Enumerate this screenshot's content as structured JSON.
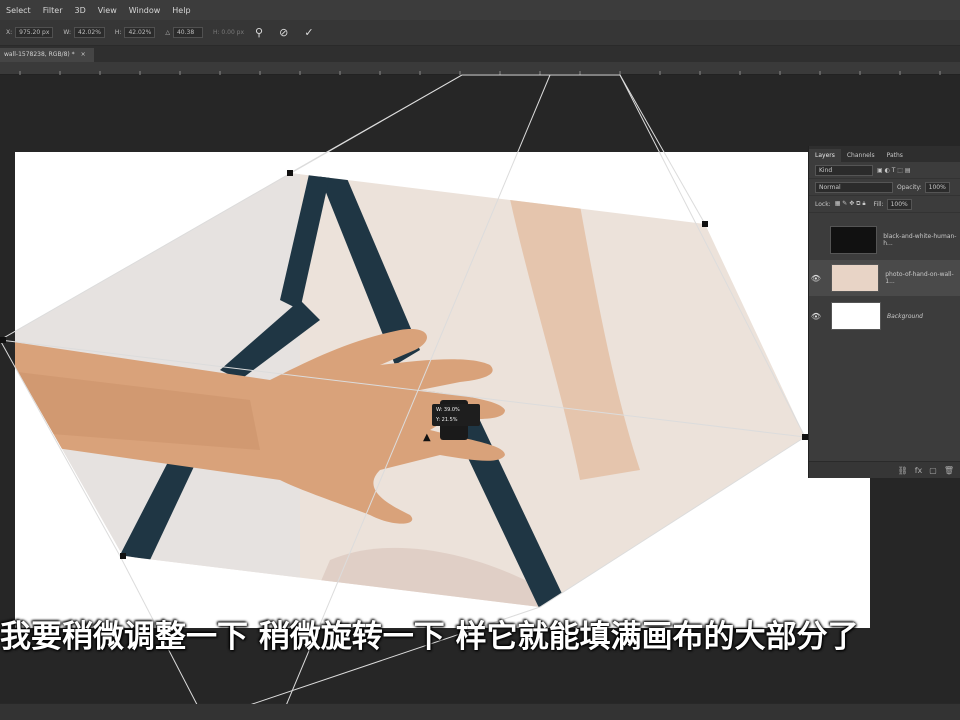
{
  "menu": [
    "Select",
    "Filter",
    "3D",
    "View",
    "Window",
    "Help"
  ],
  "options": {
    "x_label": "X:",
    "x_value": "975.20 px",
    "w_label": "W:",
    "w_value": "42.02%",
    "h_label": "H:",
    "h_value": "42.02%",
    "angle_label": "△",
    "angle_value": "40.38",
    "interp_value": "H: 0.00 px",
    "warp_icon": "puppet-warp-icon",
    "cancel_icon": "cancel-icon",
    "commit_icon": "commit-icon"
  },
  "document_tab": {
    "label": "wall-1578238, RGB/8) *",
    "close": "×"
  },
  "readout": {
    "line1": "W: 39.0%",
    "line2": "Y: 21.5%"
  },
  "subtitle": "我要稍微调整一下 稍微旋转一下 样它就能填满画布的大部分了",
  "layers_panel": {
    "tabs": [
      "Layers",
      "Channels",
      "Paths"
    ],
    "search_placeholder": "Kind",
    "blend_mode": "Normal",
    "opacity_label": "Opacity:",
    "opacity_value": "100%",
    "lock_label": "Lock:",
    "fill_label": "Fill:",
    "fill_value": "100%",
    "layers": [
      {
        "name": "black-and-white-human-h...",
        "visible": false,
        "selected": false
      },
      {
        "name": "photo-of-hand-on-wall-1...",
        "visible": true,
        "selected": true
      },
      {
        "name": "Background",
        "visible": true,
        "selected": false
      }
    ]
  },
  "colors": {
    "accent": "#1f3644",
    "skin": "#d9a27a",
    "wall": "#efe0d6"
  }
}
